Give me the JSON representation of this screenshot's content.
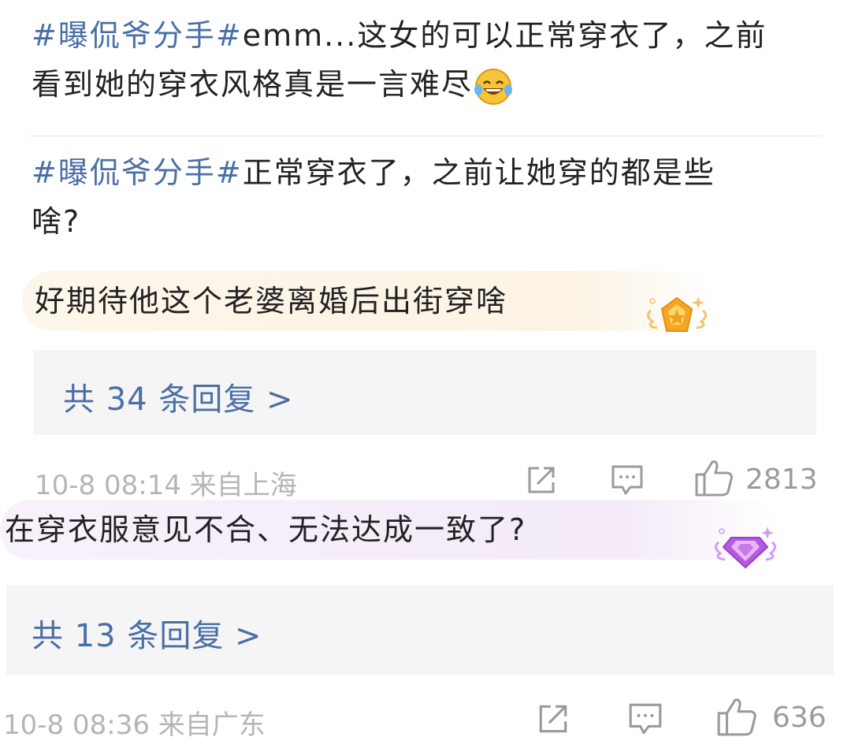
{
  "comments": [
    {
      "hashtag": "#曝侃爷分手#",
      "text": "emm...这女的可以正常穿衣了，之前",
      "text2": "看到她的穿衣风格真是一言难尽",
      "emoji": "laughing-tears-emoji"
    },
    {
      "hashtag": "#曝侃爷分手#",
      "text": "正常穿衣了，之前让她穿的都是些",
      "text2": "啥?",
      "highlight": "好期待他这个老婆离婚后出街穿啥",
      "badge": "gold-crown-badge",
      "reply_count_label": "共 34 条回复 >",
      "timestamp": "10-8 08:14  来自上海",
      "likes": "2813"
    },
    {
      "highlight": "在穿衣服意见不合、无法达成一致了?",
      "badge": "purple-diamond-badge",
      "reply_count_label": "共 13 条回复 >",
      "timestamp": "10-8 08:36  来自广东",
      "likes": "636"
    }
  ],
  "icons": [
    "share-icon",
    "comment-icon",
    "like-icon"
  ],
  "colors": {
    "hashtag": "#4a6fa5",
    "meta": "#b5b5b5",
    "reply_bg": "#f5f5f5"
  }
}
